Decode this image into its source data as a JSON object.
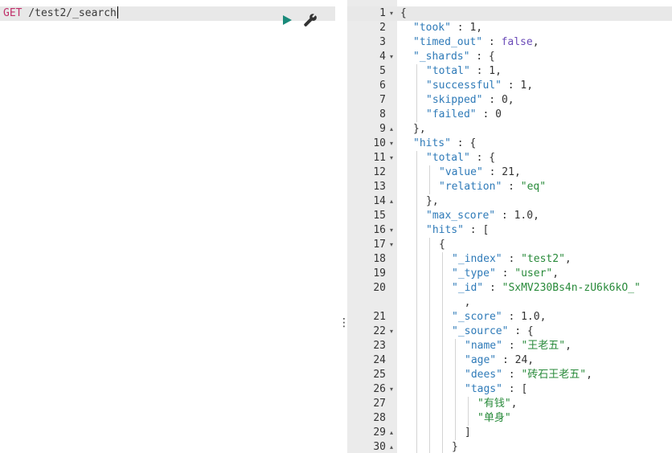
{
  "request": {
    "method": "GET",
    "path": " /test2/_search",
    "run_icon": "play-icon",
    "settings_icon": "wrench-icon"
  },
  "resizer": {
    "label": "⋮"
  },
  "response": {
    "lines": [
      {
        "n": "1",
        "fold": "▾",
        "depth": 0,
        "tokens": [
          {
            "t": "{",
            "c": "punc"
          }
        ]
      },
      {
        "n": "2",
        "fold": "",
        "depth": 1,
        "tokens": [
          {
            "t": "\"took\"",
            "c": "key"
          },
          {
            "t": " : ",
            "c": "punc"
          },
          {
            "t": "1",
            "c": "num"
          },
          {
            "t": ",",
            "c": "punc"
          }
        ]
      },
      {
        "n": "3",
        "fold": "",
        "depth": 1,
        "tokens": [
          {
            "t": "\"timed_out\"",
            "c": "key"
          },
          {
            "t": " : ",
            "c": "punc"
          },
          {
            "t": "false",
            "c": "bool"
          },
          {
            "t": ",",
            "c": "punc"
          }
        ]
      },
      {
        "n": "4",
        "fold": "▾",
        "depth": 1,
        "tokens": [
          {
            "t": "\"_shards\"",
            "c": "key"
          },
          {
            "t": " : {",
            "c": "punc"
          }
        ]
      },
      {
        "n": "5",
        "fold": "",
        "depth": 2,
        "tokens": [
          {
            "t": "\"total\"",
            "c": "key"
          },
          {
            "t": " : ",
            "c": "punc"
          },
          {
            "t": "1",
            "c": "num"
          },
          {
            "t": ",",
            "c": "punc"
          }
        ]
      },
      {
        "n": "6",
        "fold": "",
        "depth": 2,
        "tokens": [
          {
            "t": "\"successful\"",
            "c": "key"
          },
          {
            "t": " : ",
            "c": "punc"
          },
          {
            "t": "1",
            "c": "num"
          },
          {
            "t": ",",
            "c": "punc"
          }
        ]
      },
      {
        "n": "7",
        "fold": "",
        "depth": 2,
        "tokens": [
          {
            "t": "\"skipped\"",
            "c": "key"
          },
          {
            "t": " : ",
            "c": "punc"
          },
          {
            "t": "0",
            "c": "num"
          },
          {
            "t": ",",
            "c": "punc"
          }
        ]
      },
      {
        "n": "8",
        "fold": "",
        "depth": 2,
        "tokens": [
          {
            "t": "\"failed\"",
            "c": "key"
          },
          {
            "t": " : ",
            "c": "punc"
          },
          {
            "t": "0",
            "c": "num"
          }
        ]
      },
      {
        "n": "9",
        "fold": "▴",
        "depth": 1,
        "tokens": [
          {
            "t": "},",
            "c": "punc"
          }
        ]
      },
      {
        "n": "10",
        "fold": "▾",
        "depth": 1,
        "tokens": [
          {
            "t": "\"hits\"",
            "c": "key"
          },
          {
            "t": " : {",
            "c": "punc"
          }
        ]
      },
      {
        "n": "11",
        "fold": "▾",
        "depth": 2,
        "tokens": [
          {
            "t": "\"total\"",
            "c": "key"
          },
          {
            "t": " : {",
            "c": "punc"
          }
        ]
      },
      {
        "n": "12",
        "fold": "",
        "depth": 3,
        "tokens": [
          {
            "t": "\"value\"",
            "c": "key"
          },
          {
            "t": " : ",
            "c": "punc"
          },
          {
            "t": "21",
            "c": "num"
          },
          {
            "t": ",",
            "c": "punc"
          }
        ]
      },
      {
        "n": "13",
        "fold": "",
        "depth": 3,
        "tokens": [
          {
            "t": "\"relation\"",
            "c": "key"
          },
          {
            "t": " : ",
            "c": "punc"
          },
          {
            "t": "\"eq\"",
            "c": "str"
          }
        ]
      },
      {
        "n": "14",
        "fold": "▴",
        "depth": 2,
        "tokens": [
          {
            "t": "},",
            "c": "punc"
          }
        ]
      },
      {
        "n": "15",
        "fold": "",
        "depth": 2,
        "tokens": [
          {
            "t": "\"max_score\"",
            "c": "key"
          },
          {
            "t": " : ",
            "c": "punc"
          },
          {
            "t": "1.0",
            "c": "num"
          },
          {
            "t": ",",
            "c": "punc"
          }
        ]
      },
      {
        "n": "16",
        "fold": "▾",
        "depth": 2,
        "tokens": [
          {
            "t": "\"hits\"",
            "c": "key"
          },
          {
            "t": " : [",
            "c": "punc"
          }
        ]
      },
      {
        "n": "17",
        "fold": "▾",
        "depth": 3,
        "tokens": [
          {
            "t": "{",
            "c": "punc"
          }
        ]
      },
      {
        "n": "18",
        "fold": "",
        "depth": 4,
        "tokens": [
          {
            "t": "\"_index\"",
            "c": "key"
          },
          {
            "t": " : ",
            "c": "punc"
          },
          {
            "t": "\"test2\"",
            "c": "str"
          },
          {
            "t": ",",
            "c": "punc"
          }
        ]
      },
      {
        "n": "19",
        "fold": "",
        "depth": 4,
        "tokens": [
          {
            "t": "\"_type\"",
            "c": "key"
          },
          {
            "t": " : ",
            "c": "punc"
          },
          {
            "t": "\"user\"",
            "c": "str"
          },
          {
            "t": ",",
            "c": "punc"
          }
        ]
      },
      {
        "n": "20",
        "fold": "",
        "depth": 4,
        "tokens": [
          {
            "t": "\"_id\"",
            "c": "key"
          },
          {
            "t": " : ",
            "c": "punc"
          },
          {
            "t": "\"SxMV230Bs4n-zU6k6kO_\"",
            "c": "str"
          }
        ]
      },
      {
        "n": "",
        "fold": "",
        "depth": 4,
        "tokens": [
          {
            "t": "  ,",
            "c": "punc"
          }
        ]
      },
      {
        "n": "21",
        "fold": "",
        "depth": 4,
        "tokens": [
          {
            "t": "\"_score\"",
            "c": "key"
          },
          {
            "t": " : ",
            "c": "punc"
          },
          {
            "t": "1.0",
            "c": "num"
          },
          {
            "t": ",",
            "c": "punc"
          }
        ]
      },
      {
        "n": "22",
        "fold": "▾",
        "depth": 4,
        "tokens": [
          {
            "t": "\"_source\"",
            "c": "key"
          },
          {
            "t": " : {",
            "c": "punc"
          }
        ]
      },
      {
        "n": "23",
        "fold": "",
        "depth": 5,
        "tokens": [
          {
            "t": "\"name\"",
            "c": "key"
          },
          {
            "t": " : ",
            "c": "punc"
          },
          {
            "t": "\"王老五\"",
            "c": "str"
          },
          {
            "t": ",",
            "c": "punc"
          }
        ]
      },
      {
        "n": "24",
        "fold": "",
        "depth": 5,
        "tokens": [
          {
            "t": "\"age\"",
            "c": "key"
          },
          {
            "t": " : ",
            "c": "punc"
          },
          {
            "t": "24",
            "c": "num"
          },
          {
            "t": ",",
            "c": "punc"
          }
        ]
      },
      {
        "n": "25",
        "fold": "",
        "depth": 5,
        "tokens": [
          {
            "t": "\"dees\"",
            "c": "key"
          },
          {
            "t": " : ",
            "c": "punc"
          },
          {
            "t": "\"砖石王老五\"",
            "c": "str"
          },
          {
            "t": ",",
            "c": "punc"
          }
        ]
      },
      {
        "n": "26",
        "fold": "▾",
        "depth": 5,
        "tokens": [
          {
            "t": "\"tags\"",
            "c": "key"
          },
          {
            "t": " : [",
            "c": "punc"
          }
        ]
      },
      {
        "n": "27",
        "fold": "",
        "depth": 6,
        "tokens": [
          {
            "t": "\"有钱\"",
            "c": "str"
          },
          {
            "t": ",",
            "c": "punc"
          }
        ]
      },
      {
        "n": "28",
        "fold": "",
        "depth": 6,
        "tokens": [
          {
            "t": "\"单身\"",
            "c": "str"
          }
        ]
      },
      {
        "n": "29",
        "fold": "▴",
        "depth": 5,
        "tokens": [
          {
            "t": "]",
            "c": "punc"
          }
        ]
      },
      {
        "n": "30",
        "fold": "▴",
        "depth": 4,
        "tokens": [
          {
            "t": "}",
            "c": "punc"
          }
        ]
      }
    ]
  },
  "colors": {
    "method": "#c0306a",
    "key": "#2e7ab8",
    "string": "#288a3a",
    "boolean": "#6b4bb8",
    "run_button": "#1a8a7a"
  }
}
